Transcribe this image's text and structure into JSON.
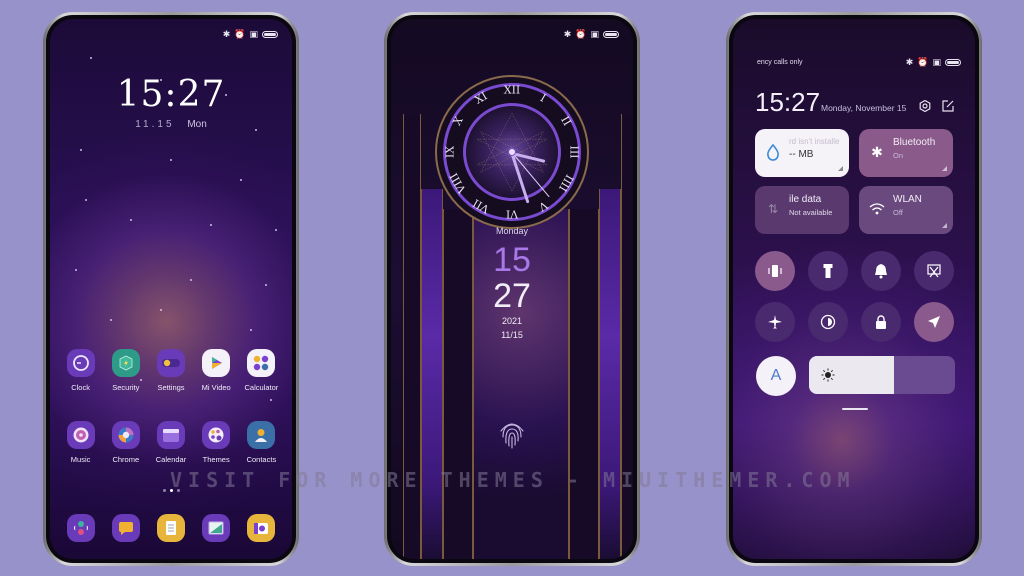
{
  "background_color": "#9792c9",
  "watermark": "VISIT FOR MORE THEMES - MIUITHEMER.COM",
  "home_screen": {
    "status_icons": [
      "bluetooth-icon",
      "alarm-icon",
      "sim-icon",
      "battery-icon"
    ],
    "time": "15:27",
    "date_num": "11.15",
    "date_day": "Mon",
    "apps_row1": [
      {
        "label": "Clock",
        "icon": "clock-icon"
      },
      {
        "label": "Security",
        "icon": "security-icon"
      },
      {
        "label": "Settings",
        "icon": "settings-icon"
      },
      {
        "label": "Mi Video",
        "icon": "mi-video-icon"
      },
      {
        "label": "Calculator",
        "icon": "calculator-icon"
      }
    ],
    "apps_row2": [
      {
        "label": "Music",
        "icon": "music-icon"
      },
      {
        "label": "Chrome",
        "icon": "chrome-icon"
      },
      {
        "label": "Calendar",
        "icon": "calendar-icon"
      },
      {
        "label": "Themes",
        "icon": "themes-icon"
      },
      {
        "label": "Contacts",
        "icon": "contacts-icon"
      }
    ],
    "dock": [
      {
        "icon": "phone-icon"
      },
      {
        "icon": "messages-icon"
      },
      {
        "icon": "notes-icon"
      },
      {
        "icon": "gallery-icon"
      },
      {
        "icon": "camera-icon"
      }
    ],
    "page_count": 3,
    "active_page": 2
  },
  "lock_screen": {
    "status_icons": [
      "bluetooth-icon",
      "alarm-icon",
      "sim-icon",
      "battery-icon"
    ],
    "roman_numerals": [
      "XII",
      "I",
      "II",
      "III",
      "IIII",
      "V",
      "VI",
      "VII",
      "VIII",
      "IX",
      "X",
      "XI"
    ],
    "day": "Monday",
    "hour": "15",
    "minute": "27",
    "year": "2021",
    "month_day": "11/15"
  },
  "control_center": {
    "carrier": "ency calls only",
    "status_icons": [
      "bluetooth-icon",
      "alarm-icon",
      "sim-icon",
      "battery-icon"
    ],
    "time": "15:27",
    "date": "Monday, November 15",
    "tiles": [
      {
        "title": "rd isn't installe",
        "sub": "-- MB",
        "icon": "data-usage-icon"
      },
      {
        "title": "Bluetooth",
        "sub": "On",
        "icon": "bluetooth-icon"
      },
      {
        "title": "ile data",
        "sub": "Not available",
        "icon": "mobile-data-icon"
      },
      {
        "title": "WLAN",
        "sub": "Off",
        "icon": "wifi-icon"
      }
    ],
    "toggles_row1": [
      {
        "icon": "vibrate-icon",
        "active": true
      },
      {
        "icon": "flashlight-icon",
        "active": false
      },
      {
        "icon": "bell-icon",
        "active": false
      },
      {
        "icon": "screenshot-icon",
        "active": false
      }
    ],
    "toggles_row2": [
      {
        "icon": "airplane-icon",
        "active": false
      },
      {
        "icon": "dark-mode-icon",
        "active": false
      },
      {
        "icon": "lock-icon",
        "active": false
      },
      {
        "icon": "location-icon",
        "active": true
      }
    ],
    "auto_brightness_label": "A",
    "brightness_percent": 58
  }
}
